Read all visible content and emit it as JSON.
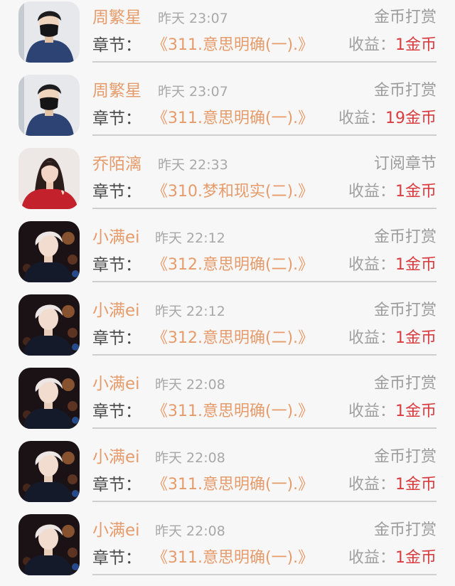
{
  "app": {
    "accent_orange": "#e69b6b",
    "accent_red": "#d93b3f",
    "muted_gray": "#a8a8a8"
  },
  "records": [
    {
      "username": "周繁星",
      "time": "昨天 23:07",
      "type": "金币打赏",
      "chapter_label": "章节：",
      "chapter_title": "《311.意思明确(一).》",
      "earnings_label": "收益：",
      "earnings_value": "1金币",
      "avatar": "masked-male-avatar"
    },
    {
      "username": "周繁星",
      "time": "昨天 23:07",
      "type": "金币打赏",
      "chapter_label": "章节：",
      "chapter_title": "《311.意思明确(一).》",
      "earnings_label": "收益：",
      "earnings_value": "19金币",
      "avatar": "masked-male-avatar"
    },
    {
      "username": "乔陌漓",
      "time": "昨天 22:33",
      "type": "订阅章节",
      "chapter_label": "章节：",
      "chapter_title": "《310.梦和现实(二).》",
      "earnings_label": "收益：",
      "earnings_value": "1金币",
      "avatar": "female-red-outfit-avatar"
    },
    {
      "username": "小满ei",
      "time": "昨天 22:12",
      "type": "金币打赏",
      "chapter_label": "章节：",
      "chapter_title": "《312.意思明确(二).》",
      "earnings_label": "收益：",
      "earnings_value": "1金币",
      "avatar": "blond-male-avatar"
    },
    {
      "username": "小满ei",
      "time": "昨天 22:12",
      "type": "金币打赏",
      "chapter_label": "章节：",
      "chapter_title": "《312.意思明确(二).》",
      "earnings_label": "收益：",
      "earnings_value": "1金币",
      "avatar": "blond-male-avatar"
    },
    {
      "username": "小满ei",
      "time": "昨天 22:08",
      "type": "金币打赏",
      "chapter_label": "章节：",
      "chapter_title": "《311.意思明确(一).》",
      "earnings_label": "收益：",
      "earnings_value": "1金币",
      "avatar": "blond-male-avatar"
    },
    {
      "username": "小满ei",
      "time": "昨天 22:08",
      "type": "金币打赏",
      "chapter_label": "章节：",
      "chapter_title": "《311.意思明确(一).》",
      "earnings_label": "收益：",
      "earnings_value": "1金币",
      "avatar": "blond-male-avatar"
    },
    {
      "username": "小满ei",
      "time": "昨天 22:08",
      "type": "金币打赏",
      "chapter_label": "章节：",
      "chapter_title": "《311.意思明确(一).》",
      "earnings_label": "收益：",
      "earnings_value": "1金币",
      "avatar": "blond-male-avatar"
    }
  ]
}
